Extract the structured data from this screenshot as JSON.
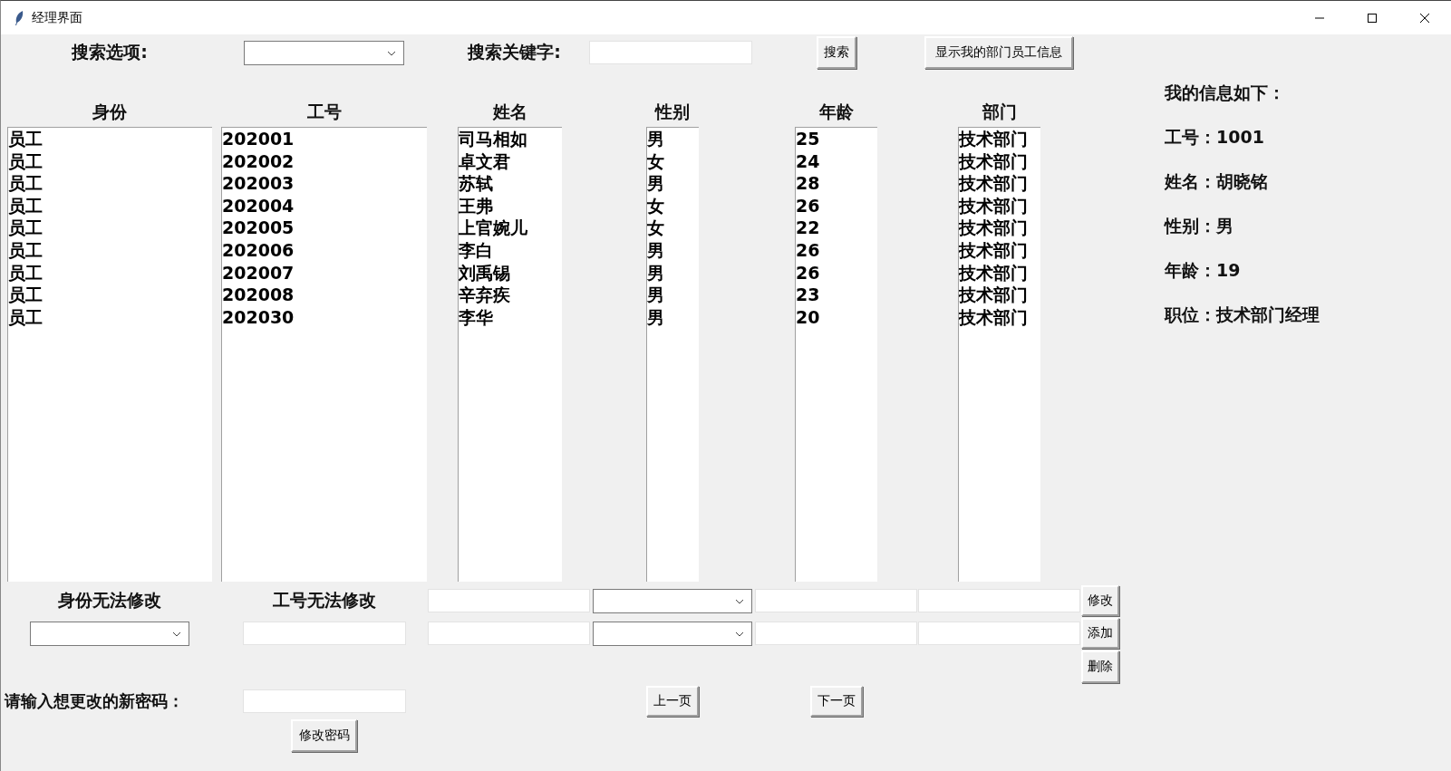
{
  "window": {
    "title": "经理界面"
  },
  "search": {
    "option_label": "搜索选项:",
    "keyword_label": "搜索关键字:",
    "search_button": "搜索",
    "show_button": "显示我的部门员工信息"
  },
  "table": {
    "columns": [
      "身份",
      "工号",
      "姓名",
      "性别",
      "年龄",
      "部门"
    ],
    "rows": [
      [
        "员工",
        "202001",
        "司马相如",
        "男",
        "25",
        "技术部门"
      ],
      [
        "员工",
        "202002",
        "卓文君",
        "女",
        "24",
        "技术部门"
      ],
      [
        "员工",
        "202003",
        "苏轼",
        "男",
        "28",
        "技术部门"
      ],
      [
        "员工",
        "202004",
        "王弗",
        "女",
        "26",
        "技术部门"
      ],
      [
        "员工",
        "202005",
        "上官婉儿",
        "女",
        "22",
        "技术部门"
      ],
      [
        "员工",
        "202006",
        "李白",
        "男",
        "26",
        "技术部门"
      ],
      [
        "员工",
        "202007",
        "刘禹锡",
        "男",
        "26",
        "技术部门"
      ],
      [
        "员工",
        "202008",
        "辛弃疾",
        "男",
        "23",
        "技术部门"
      ],
      [
        "员工",
        "202030",
        "李华",
        "男",
        "20",
        "技术部门"
      ]
    ]
  },
  "my_info": {
    "heading": "我的信息如下：",
    "lines": [
      "工号：1001",
      "姓名：胡晓铭",
      "性别：男",
      "年龄：19",
      "职位：技术部门经理"
    ]
  },
  "edit": {
    "identity_note": "身份无法修改",
    "id_note": "工号无法修改",
    "buttons": [
      "修改",
      "添加",
      "删除"
    ]
  },
  "password": {
    "label": "请输入想更改的新密码：",
    "button": "修改密码"
  },
  "paging": {
    "prev": "上一页",
    "next": "下一页"
  }
}
